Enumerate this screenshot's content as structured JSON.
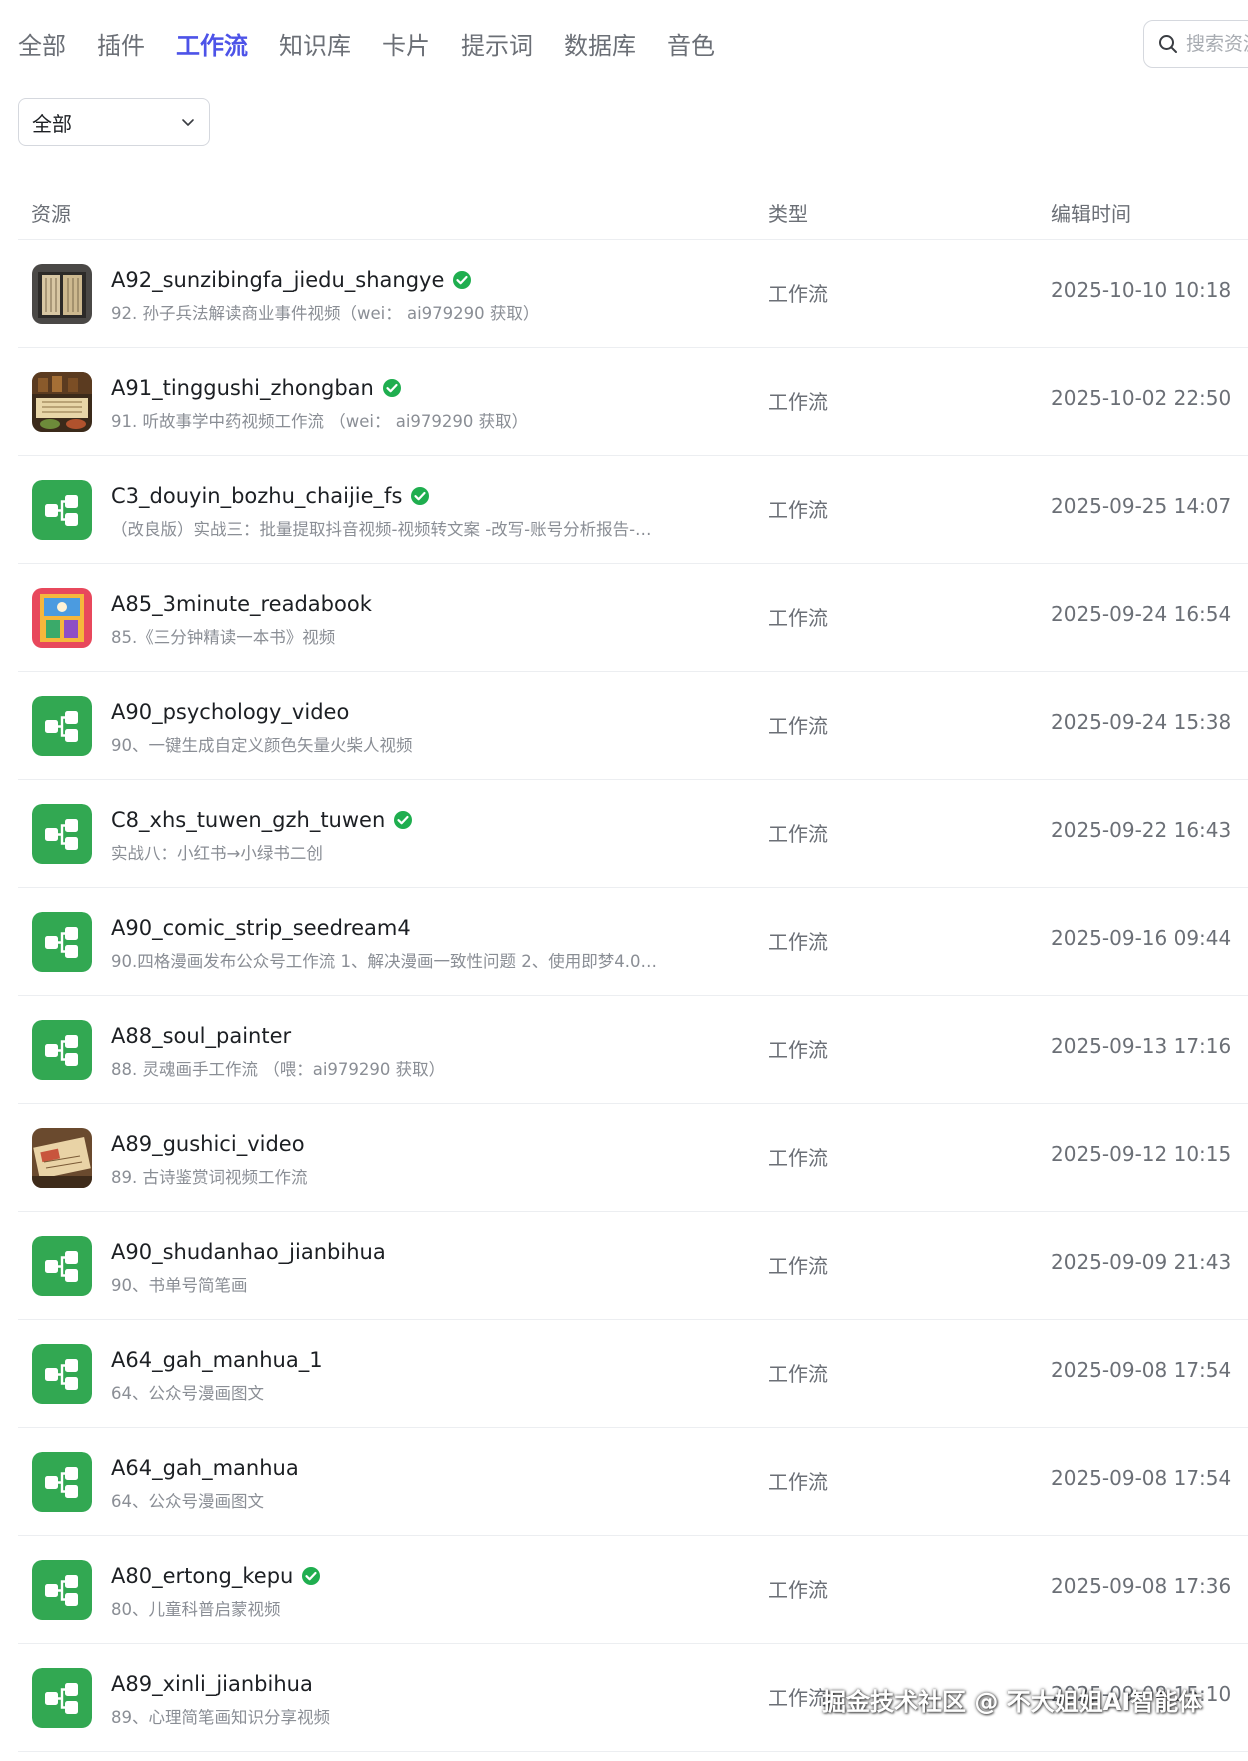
{
  "tabs": [
    {
      "label": "全部",
      "active": false
    },
    {
      "label": "插件",
      "active": false
    },
    {
      "label": "工作流",
      "active": true
    },
    {
      "label": "知识库",
      "active": false
    },
    {
      "label": "卡片",
      "active": false
    },
    {
      "label": "提示词",
      "active": false
    },
    {
      "label": "数据库",
      "active": false
    },
    {
      "label": "音色",
      "active": false
    }
  ],
  "search": {
    "placeholder": "搜索资源",
    "icon": "search-icon"
  },
  "filter": {
    "selected": "全部",
    "icon": "chevron-down-icon"
  },
  "table": {
    "headers": {
      "resource": "资源",
      "type": "类型",
      "edit_time": "编辑时间"
    },
    "rows": [
      {
        "name": "A92_sunzibingfa_jiedu_shangye",
        "verified": true,
        "desc": "92. 孙子兵法解读商业事件视频（wei： ai979290 获取）",
        "type": "工作流",
        "time": "2025-10-10 10:18",
        "thumb": "book-thumbnail"
      },
      {
        "name": "A91_tinggushi_zhongban",
        "verified": true,
        "desc": "91. 听故事学中药视频工作流 （wei： ai979290 获取）",
        "type": "工作流",
        "time": "2025-10-02 22:50",
        "thumb": "herbal-thumbnail"
      },
      {
        "name": "C3_douyin_bozhu_chaijie_fs",
        "verified": true,
        "desc": "（改良版）实战三：批量提取抖音视频-视频转文案 -改写-账号分析报告-…",
        "type": "工作流",
        "time": "2025-09-25 14:07",
        "thumb": "workflow-icon"
      },
      {
        "name": "A85_3minute_readabook",
        "verified": false,
        "desc": "85.《三分钟精读一本书》视频",
        "type": "工作流",
        "time": "2025-09-24 16:54",
        "thumb": "colorful-book-thumbnail"
      },
      {
        "name": "A90_psychology_video",
        "verified": false,
        "desc": "90、一键生成自定义颜色矢量火柴人视频",
        "type": "工作流",
        "time": "2025-09-24 15:38",
        "thumb": "workflow-icon"
      },
      {
        "name": "C8_xhs_tuwen_gzh_tuwen",
        "verified": true,
        "desc": "实战八：小红书→小绿书二创",
        "type": "工作流",
        "time": "2025-09-22 16:43",
        "thumb": "workflow-icon"
      },
      {
        "name": "A90_comic_strip_seedream4",
        "verified": false,
        "desc": "90.四格漫画发布公众号工作流 1、解决漫画一致性问题 2、使用即梦4.0…",
        "type": "工作流",
        "time": "2025-09-16 09:44",
        "thumb": "workflow-icon"
      },
      {
        "name": "A88_soul_painter",
        "verified": false,
        "desc": "88. 灵魂画手工作流 （喂：ai979290 获取）",
        "type": "工作流",
        "time": "2025-09-13 17:16",
        "thumb": "workflow-icon"
      },
      {
        "name": "A89_gushici_video",
        "verified": false,
        "desc": "89. 古诗鉴赏词视频工作流",
        "type": "工作流",
        "time": "2025-09-12 10:15",
        "thumb": "scroll-thumbnail"
      },
      {
        "name": "A90_shudanhao_jianbihua",
        "verified": false,
        "desc": "90、书单号简笔画",
        "type": "工作流",
        "time": "2025-09-09 21:43",
        "thumb": "workflow-icon"
      },
      {
        "name": "A64_gah_manhua_1",
        "verified": false,
        "desc": "64、公众号漫画图文",
        "type": "工作流",
        "time": "2025-09-08 17:54",
        "thumb": "workflow-icon"
      },
      {
        "name": "A64_gah_manhua",
        "verified": false,
        "desc": "64、公众号漫画图文",
        "type": "工作流",
        "time": "2025-09-08 17:54",
        "thumb": "workflow-icon"
      },
      {
        "name": "A80_ertong_kepu",
        "verified": true,
        "desc": "80、儿童科普启蒙视频",
        "type": "工作流",
        "time": "2025-09-08 17:36",
        "thumb": "workflow-icon"
      },
      {
        "name": "A89_xinli_jianbihua",
        "verified": false,
        "desc": "89、心理简笔画知识分享视频",
        "type": "工作流",
        "time": "2025-09-08 15:10",
        "thumb": "workflow-icon"
      }
    ]
  },
  "watermark": "掘金技术社区 @ 不大姐姐AI智能体",
  "colors": {
    "accent": "#4d53e8",
    "workflow_green": "#32a852",
    "verified_green": "#1fae4f"
  }
}
